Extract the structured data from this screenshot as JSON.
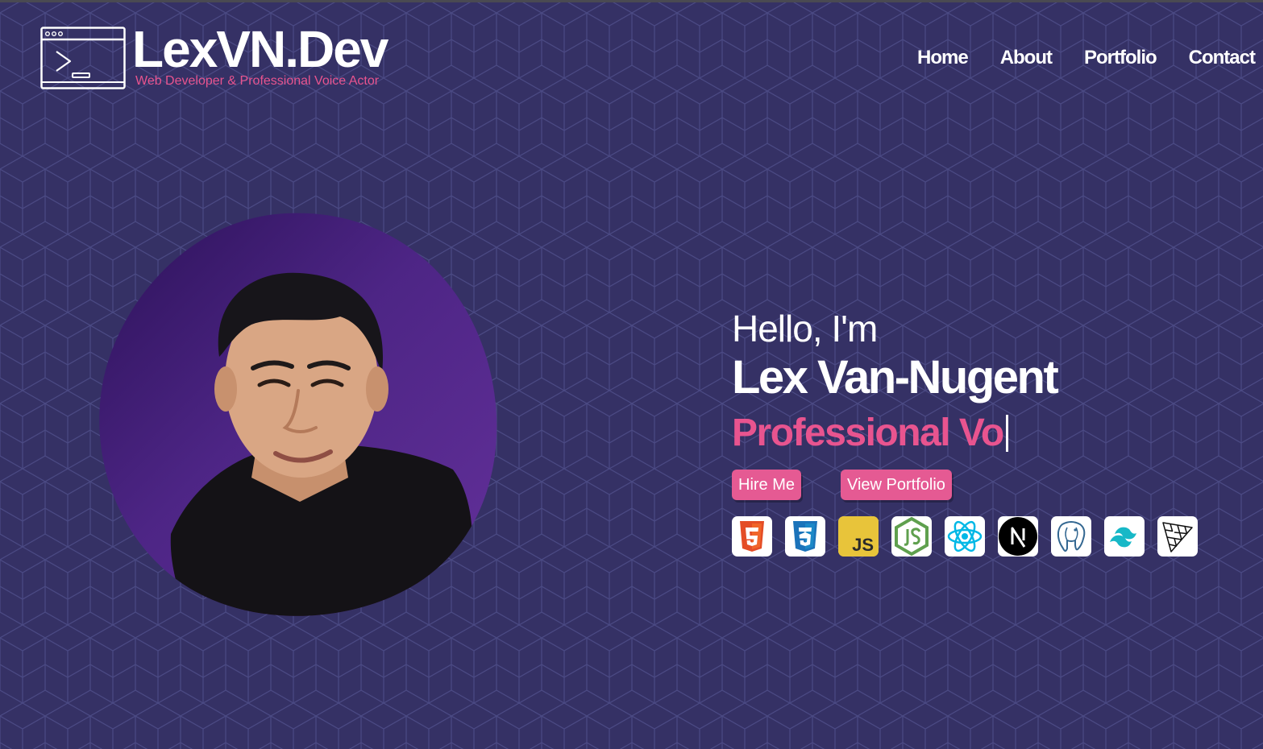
{
  "brand": {
    "name": "LexVN.Dev",
    "tagline": "Web Developer & Professional Voice Actor",
    "logo_icon": "terminal-window-icon"
  },
  "nav": {
    "items": [
      {
        "label": "Home"
      },
      {
        "label": "About"
      },
      {
        "label": "Portfolio"
      },
      {
        "label": "Contact"
      }
    ]
  },
  "hero": {
    "greeting": "Hello, I'm",
    "name": "Lex Van-Nugent",
    "typed_text": "Professional Vo",
    "buttons": {
      "hire": "Hire Me",
      "portfolio": "View Portfolio"
    },
    "js_badge": "JS"
  },
  "tech_icons": [
    "html5-icon",
    "css3-icon",
    "javascript-icon",
    "nodejs-icon",
    "react-icon",
    "nextjs-icon",
    "postgresql-icon",
    "tailwind-icon",
    "threejs-icon"
  ],
  "colors": {
    "background": "#353165",
    "accent_pink": "#e8548f",
    "button_pink": "#e55a93",
    "blob_purple": "#5a2a8c"
  }
}
